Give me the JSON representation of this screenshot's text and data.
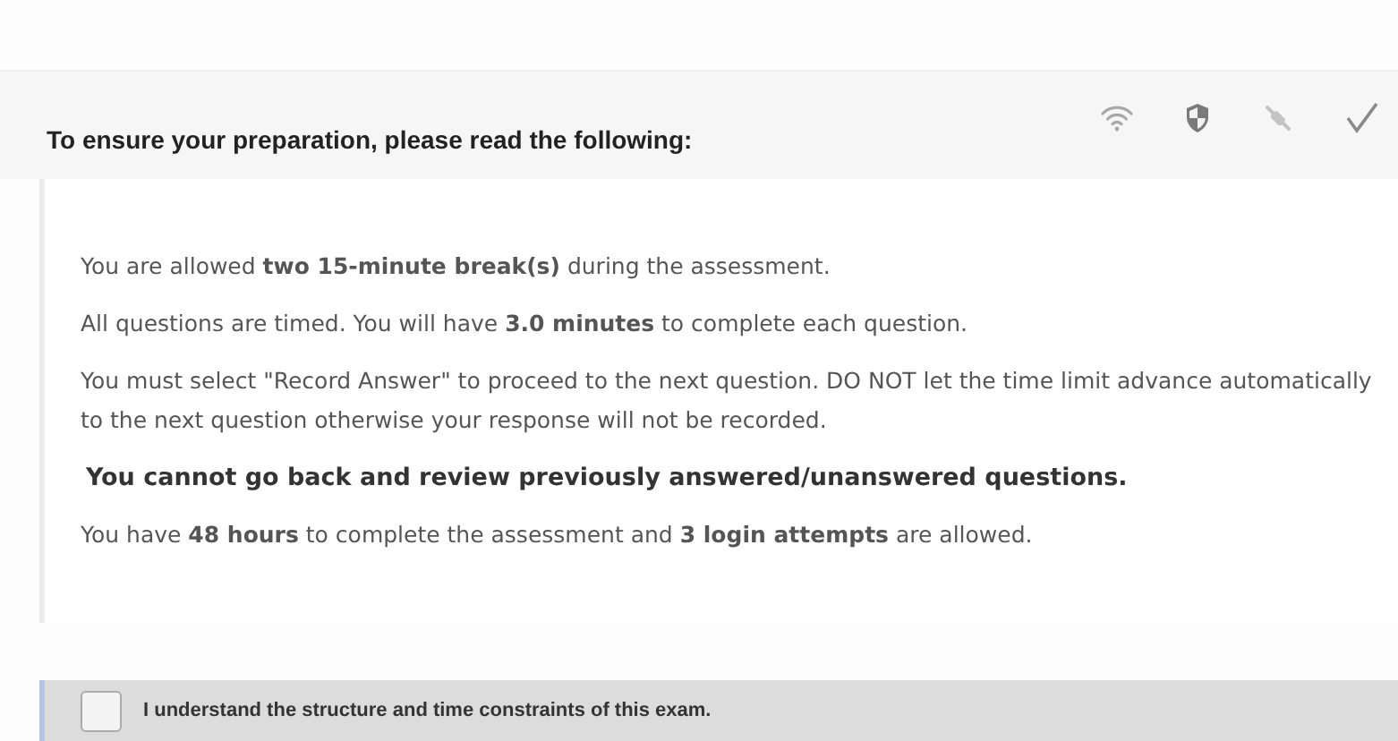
{
  "header": {
    "title": "To ensure your preparation, please read the following:"
  },
  "status_icons": [
    {
      "kind": "wifi"
    },
    {
      "kind": "shield"
    },
    {
      "kind": "plug"
    },
    {
      "kind": "check"
    }
  ],
  "notices": [
    {
      "kind": "text",
      "text": "You are allowed **two 15-minute break(s)** during the assessment."
    },
    {
      "kind": "text",
      "text": "All questions are timed. You will have **3.0 minutes** to complete each question."
    },
    {
      "kind": "text",
      "text": "You must select \"Record Answer\" to proceed to the next question. DO NOT let the time limit advance automatically to the next question otherwise your response will not be recorded."
    },
    {
      "kind": "emphasis",
      "text": "You cannot go back and review previously answered/unanswered questions."
    },
    {
      "kind": "text",
      "text": "You have **48 hours** to complete the assessment and  **3 login attempts** are allowed."
    }
  ],
  "agreement": {
    "label": "I understand the structure and time constraints of this exam.",
    "checked": false
  }
}
